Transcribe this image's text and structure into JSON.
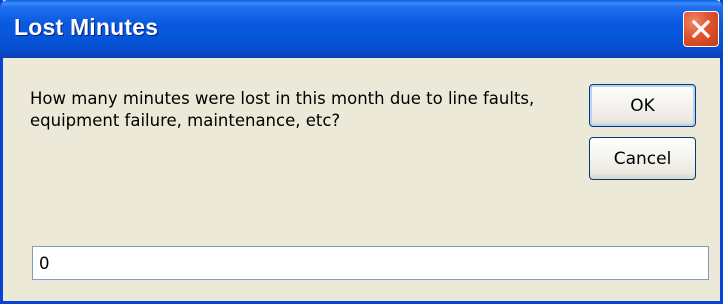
{
  "window": {
    "title": "Lost Minutes",
    "close_icon": "close-icon"
  },
  "dialog": {
    "prompt": "How many minutes were lost in this month due to line faults, equipment failure, maintenance, etc?",
    "ok_label": "OK",
    "cancel_label": "Cancel"
  },
  "input": {
    "value": "0"
  },
  "colors": {
    "titlebar": "#0a5ae0",
    "frame": "#0842d6",
    "face": "#ece9d8",
    "close": "#e0532e"
  }
}
